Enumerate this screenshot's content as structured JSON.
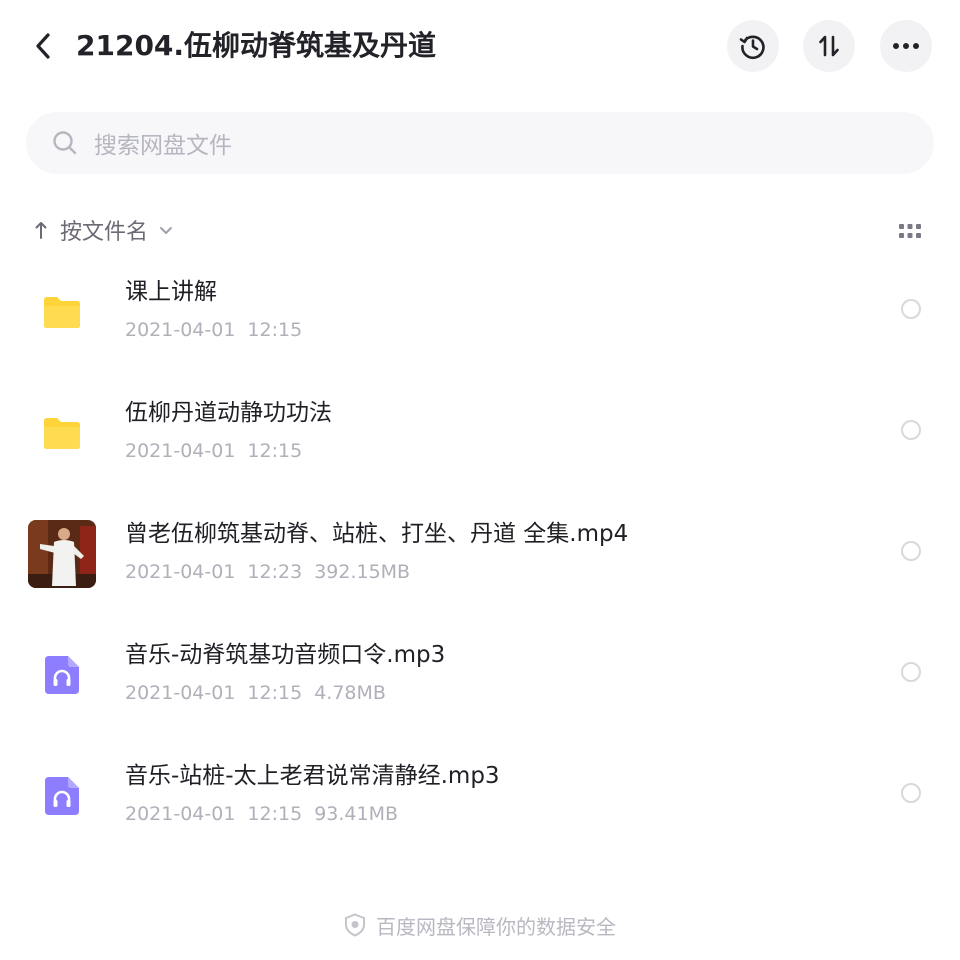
{
  "header": {
    "title": "21204.伍柳动脊筑基及丹道",
    "icons": [
      "chevron-left-icon",
      "history-icon",
      "sort-icon",
      "more-icon"
    ]
  },
  "search": {
    "placeholder": "搜索网盘文件"
  },
  "sort": {
    "label": "按文件名"
  },
  "files": [
    {
      "type": "folder",
      "name": "课上讲解",
      "date": "2021-04-01",
      "time": "12:15",
      "size": ""
    },
    {
      "type": "folder",
      "name": "伍柳丹道动静功功法",
      "date": "2021-04-01",
      "time": "12:15",
      "size": ""
    },
    {
      "type": "video",
      "name": "曾老伍柳筑基动脊、站桩、打坐、丹道 全集.mp4",
      "date": "2021-04-01",
      "time": "12:23",
      "size": "392.15MB"
    },
    {
      "type": "audio",
      "name": "音乐-动脊筑基功音频口令.mp3",
      "date": "2021-04-01",
      "time": "12:15",
      "size": "4.78MB"
    },
    {
      "type": "audio",
      "name": "音乐-站桩-太上老君说常清静经.mp3",
      "date": "2021-04-01",
      "time": "12:15",
      "size": "93.41MB"
    }
  ],
  "footer": {
    "text": "百度网盘保障你的数据安全"
  },
  "colors": {
    "folder": "#ffd43b",
    "audio": "#8d7dff",
    "button_bg": "#f2f2f5",
    "search_bg": "#f7f7fa"
  }
}
